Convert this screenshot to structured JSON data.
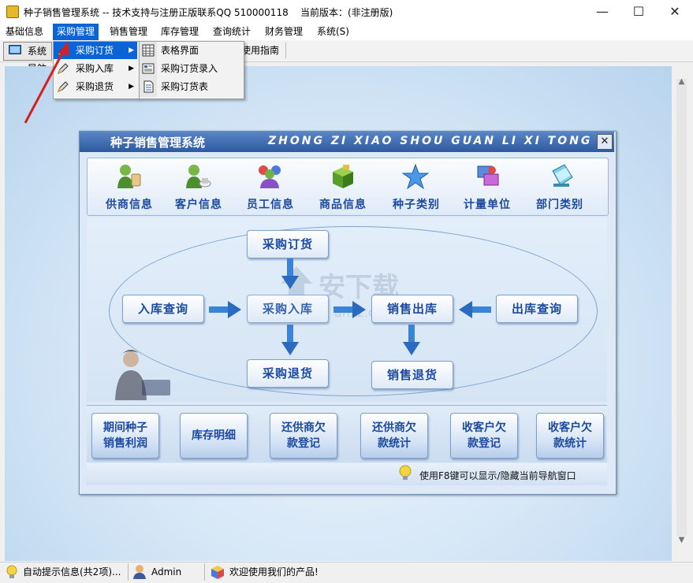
{
  "window": {
    "title": "种子销售管理系统 -- 技术支持与注册正版联系QQ 510000118    当前版本：(非注册版)",
    "minimize_glyph": "—",
    "maximize_glyph": "☐",
    "close_glyph": "✕"
  },
  "menubar": {
    "items": [
      {
        "label": "基础信息"
      },
      {
        "label": "采购管理"
      },
      {
        "label": "销售管理"
      },
      {
        "label": "库存管理"
      },
      {
        "label": "查询统计"
      },
      {
        "label": "财务管理"
      },
      {
        "label": "系统(S)"
      }
    ],
    "active_index": 1
  },
  "toolbar": {
    "nav_label": "系统导航",
    "guide_label": "使用指南"
  },
  "dropdown": {
    "items": [
      {
        "label": "采购订货",
        "icon": "pencil-icon",
        "has_submenu": true
      },
      {
        "label": "采购入库",
        "icon": "pencil-icon",
        "has_submenu": true
      },
      {
        "label": "采购退货",
        "icon": "pencil-icon",
        "has_submenu": true
      }
    ],
    "highlighted_index": 0,
    "submenu_arrow": "▶"
  },
  "submenu": {
    "items": [
      {
        "label": "表格界面",
        "icon": "grid-icon"
      },
      {
        "label": "采购订货录入",
        "icon": "form-icon"
      },
      {
        "label": "采购订货表",
        "icon": "document-icon"
      }
    ]
  },
  "nav_window": {
    "title": "种子销售管理系统",
    "title_en": "ZHONG ZI XIAO SHOU GUAN LI XI TONG",
    "close_glyph": "✕",
    "top_items": [
      {
        "label": "供商信息",
        "icon": "supplier-icon"
      },
      {
        "label": "客户信息",
        "icon": "customer-icon"
      },
      {
        "label": "员工信息",
        "icon": "staff-icon"
      },
      {
        "label": "商品信息",
        "icon": "product-icon"
      },
      {
        "label": "种子类别",
        "icon": "star-icon"
      },
      {
        "label": "计量单位",
        "icon": "unit-icon"
      },
      {
        "label": "部门类别",
        "icon": "department-icon"
      }
    ],
    "flow": {
      "purchase_order": "采购订货",
      "stock_in_query": "入库查询",
      "purchase_in": "采购入库",
      "sales_out": "销售出库",
      "stock_out_query": "出库查询",
      "purchase_return": "采购退货",
      "sales_return": "销售退货"
    },
    "bottom_buttons": [
      {
        "line1": "期间种子",
        "line2": "销售利润"
      },
      {
        "line1": "库存明细",
        "line2": ""
      },
      {
        "line1": "还供商欠",
        "line2": "款登记"
      },
      {
        "line1": "还供商欠",
        "line2": "款统计"
      },
      {
        "line1": "收客户欠",
        "line2": "款登记"
      },
      {
        "line1": "收客户欠",
        "line2": "款统计"
      }
    ],
    "hint": "使用F8键可以显示/隐藏当前导航窗口"
  },
  "watermark": {
    "text": "安下载",
    "sub": "anxz.com"
  },
  "statusbar": {
    "tips": "自动提示信息(共2项)...",
    "user": "Admin",
    "welcome": "欢迎使用我们的产品!"
  },
  "colors": {
    "menu_highlight": "#0a64d8",
    "nav_label": "#1c4aa0",
    "annotation_arrow": "#d42020"
  }
}
